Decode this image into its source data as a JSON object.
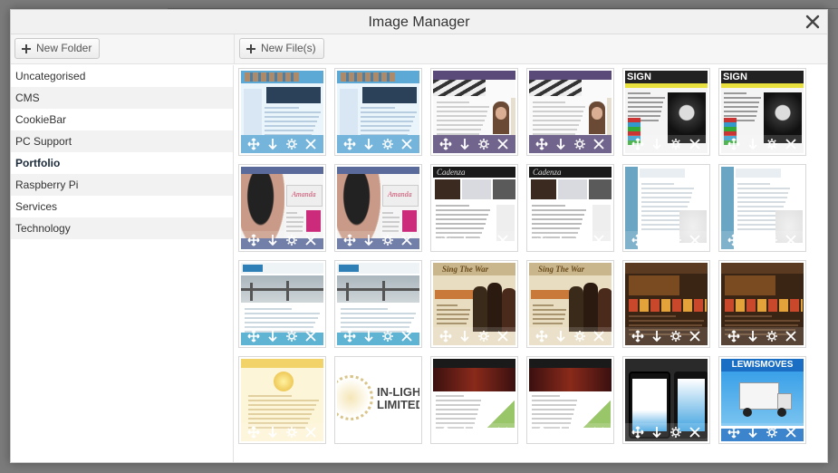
{
  "modal": {
    "title": "Image Manager",
    "close_label": "✕"
  },
  "toolbar": {
    "new_folder_label": "New Folder",
    "new_files_label": "New File(s)"
  },
  "folders": [
    {
      "label": "Uncategorised",
      "active": false
    },
    {
      "label": "CMS",
      "active": false
    },
    {
      "label": "CookieBar",
      "active": false
    },
    {
      "label": "PC Support",
      "active": false
    },
    {
      "label": "Portfolio",
      "active": true
    },
    {
      "label": "Raspberry Pi",
      "active": false
    },
    {
      "label": "Services",
      "active": false
    },
    {
      "label": "Technology",
      "active": false
    }
  ],
  "thumbnails": [
    {
      "style": "blue-site",
      "text": ""
    },
    {
      "style": "blue-site",
      "text": ""
    },
    {
      "style": "purple-portrait",
      "text": ""
    },
    {
      "style": "purple-portrait",
      "text": ""
    },
    {
      "style": "sign",
      "text": "SIGN"
    },
    {
      "style": "sign",
      "text": "SIGN"
    },
    {
      "style": "woman",
      "text": ""
    },
    {
      "style": "woman",
      "text": ""
    },
    {
      "style": "dark-theatre",
      "text": ""
    },
    {
      "style": "dark-theatre",
      "text": ""
    },
    {
      "style": "light-blue",
      "text": ""
    },
    {
      "style": "light-blue",
      "text": ""
    },
    {
      "style": "bridge",
      "text": ""
    },
    {
      "style": "bridge",
      "text": ""
    },
    {
      "style": "sing",
      "text": "Sing The War"
    },
    {
      "style": "sing",
      "text": "Sing The War"
    },
    {
      "style": "brown",
      "text": ""
    },
    {
      "style": "brown",
      "text": ""
    },
    {
      "style": "yellow",
      "text": ""
    },
    {
      "style": "inlight",
      "text": "IN-LIGH\nLIMITED"
    },
    {
      "style": "dark-red",
      "text": ""
    },
    {
      "style": "dark-red",
      "text": ""
    },
    {
      "style": "phones",
      "text": ""
    },
    {
      "style": "lewis",
      "text": "LEWISMOVES"
    }
  ],
  "thumb_actions": [
    "move-icon",
    "download-icon",
    "settings-icon",
    "delete-icon"
  ]
}
